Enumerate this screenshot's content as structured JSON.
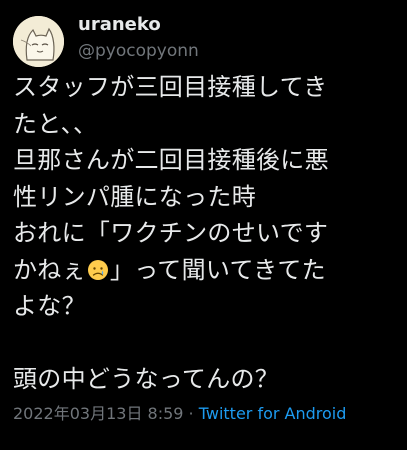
{
  "user": {
    "display_name": "uraneko",
    "handle": "@pyocopyonn",
    "avatar_icon": "cat-sketch-avatar-icon"
  },
  "tweet": {
    "lines": [
      "スタッフが三回目接種してき",
      "たと、、",
      "旦那さんが二回目接種後に悪",
      "性リンパ腫になった時",
      "おれに「ワクチンのせいです"
    ],
    "line6_before_emoji": "かねぇ",
    "emoji": "crying-face-emoji",
    "line6_after_emoji": "」って聞いてきてた",
    "line7": "よな？",
    "line9": "頭の中どうなってんの？"
  },
  "meta": {
    "timestamp": "2022年03月13日 8:59",
    "separator": " · ",
    "source": "Twitter for Android"
  },
  "colors": {
    "background": "#000000",
    "text": "#e7e9ea",
    "secondary": "#71767b",
    "link": "#1d9bf0"
  }
}
